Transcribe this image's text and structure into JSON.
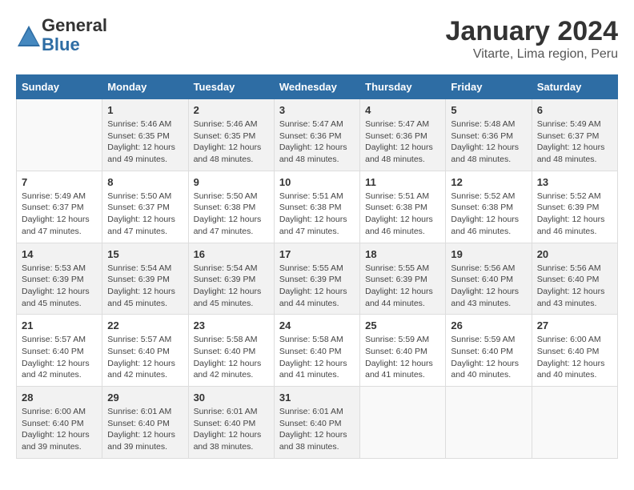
{
  "header": {
    "logo_line1": "General",
    "logo_line2": "Blue",
    "title": "January 2024",
    "subtitle": "Vitarte, Lima region, Peru"
  },
  "calendar": {
    "days_of_week": [
      "Sunday",
      "Monday",
      "Tuesday",
      "Wednesday",
      "Thursday",
      "Friday",
      "Saturday"
    ],
    "weeks": [
      [
        {
          "day": "",
          "info": ""
        },
        {
          "day": "1",
          "info": "Sunrise: 5:46 AM\nSunset: 6:35 PM\nDaylight: 12 hours\nand 49 minutes."
        },
        {
          "day": "2",
          "info": "Sunrise: 5:46 AM\nSunset: 6:35 PM\nDaylight: 12 hours\nand 48 minutes."
        },
        {
          "day": "3",
          "info": "Sunrise: 5:47 AM\nSunset: 6:36 PM\nDaylight: 12 hours\nand 48 minutes."
        },
        {
          "day": "4",
          "info": "Sunrise: 5:47 AM\nSunset: 6:36 PM\nDaylight: 12 hours\nand 48 minutes."
        },
        {
          "day": "5",
          "info": "Sunrise: 5:48 AM\nSunset: 6:36 PM\nDaylight: 12 hours\nand 48 minutes."
        },
        {
          "day": "6",
          "info": "Sunrise: 5:49 AM\nSunset: 6:37 PM\nDaylight: 12 hours\nand 48 minutes."
        }
      ],
      [
        {
          "day": "7",
          "info": "Sunrise: 5:49 AM\nSunset: 6:37 PM\nDaylight: 12 hours\nand 47 minutes."
        },
        {
          "day": "8",
          "info": "Sunrise: 5:50 AM\nSunset: 6:37 PM\nDaylight: 12 hours\nand 47 minutes."
        },
        {
          "day": "9",
          "info": "Sunrise: 5:50 AM\nSunset: 6:38 PM\nDaylight: 12 hours\nand 47 minutes."
        },
        {
          "day": "10",
          "info": "Sunrise: 5:51 AM\nSunset: 6:38 PM\nDaylight: 12 hours\nand 47 minutes."
        },
        {
          "day": "11",
          "info": "Sunrise: 5:51 AM\nSunset: 6:38 PM\nDaylight: 12 hours\nand 46 minutes."
        },
        {
          "day": "12",
          "info": "Sunrise: 5:52 AM\nSunset: 6:38 PM\nDaylight: 12 hours\nand 46 minutes."
        },
        {
          "day": "13",
          "info": "Sunrise: 5:52 AM\nSunset: 6:39 PM\nDaylight: 12 hours\nand 46 minutes."
        }
      ],
      [
        {
          "day": "14",
          "info": "Sunrise: 5:53 AM\nSunset: 6:39 PM\nDaylight: 12 hours\nand 45 minutes."
        },
        {
          "day": "15",
          "info": "Sunrise: 5:54 AM\nSunset: 6:39 PM\nDaylight: 12 hours\nand 45 minutes."
        },
        {
          "day": "16",
          "info": "Sunrise: 5:54 AM\nSunset: 6:39 PM\nDaylight: 12 hours\nand 45 minutes."
        },
        {
          "day": "17",
          "info": "Sunrise: 5:55 AM\nSunset: 6:39 PM\nDaylight: 12 hours\nand 44 minutes."
        },
        {
          "day": "18",
          "info": "Sunrise: 5:55 AM\nSunset: 6:39 PM\nDaylight: 12 hours\nand 44 minutes."
        },
        {
          "day": "19",
          "info": "Sunrise: 5:56 AM\nSunset: 6:40 PM\nDaylight: 12 hours\nand 43 minutes."
        },
        {
          "day": "20",
          "info": "Sunrise: 5:56 AM\nSunset: 6:40 PM\nDaylight: 12 hours\nand 43 minutes."
        }
      ],
      [
        {
          "day": "21",
          "info": "Sunrise: 5:57 AM\nSunset: 6:40 PM\nDaylight: 12 hours\nand 42 minutes."
        },
        {
          "day": "22",
          "info": "Sunrise: 5:57 AM\nSunset: 6:40 PM\nDaylight: 12 hours\nand 42 minutes."
        },
        {
          "day": "23",
          "info": "Sunrise: 5:58 AM\nSunset: 6:40 PM\nDaylight: 12 hours\nand 42 minutes."
        },
        {
          "day": "24",
          "info": "Sunrise: 5:58 AM\nSunset: 6:40 PM\nDaylight: 12 hours\nand 41 minutes."
        },
        {
          "day": "25",
          "info": "Sunrise: 5:59 AM\nSunset: 6:40 PM\nDaylight: 12 hours\nand 41 minutes."
        },
        {
          "day": "26",
          "info": "Sunrise: 5:59 AM\nSunset: 6:40 PM\nDaylight: 12 hours\nand 40 minutes."
        },
        {
          "day": "27",
          "info": "Sunrise: 6:00 AM\nSunset: 6:40 PM\nDaylight: 12 hours\nand 40 minutes."
        }
      ],
      [
        {
          "day": "28",
          "info": "Sunrise: 6:00 AM\nSunset: 6:40 PM\nDaylight: 12 hours\nand 39 minutes."
        },
        {
          "day": "29",
          "info": "Sunrise: 6:01 AM\nSunset: 6:40 PM\nDaylight: 12 hours\nand 39 minutes."
        },
        {
          "day": "30",
          "info": "Sunrise: 6:01 AM\nSunset: 6:40 PM\nDaylight: 12 hours\nand 38 minutes."
        },
        {
          "day": "31",
          "info": "Sunrise: 6:01 AM\nSunset: 6:40 PM\nDaylight: 12 hours\nand 38 minutes."
        },
        {
          "day": "",
          "info": ""
        },
        {
          "day": "",
          "info": ""
        },
        {
          "day": "",
          "info": ""
        }
      ]
    ]
  }
}
